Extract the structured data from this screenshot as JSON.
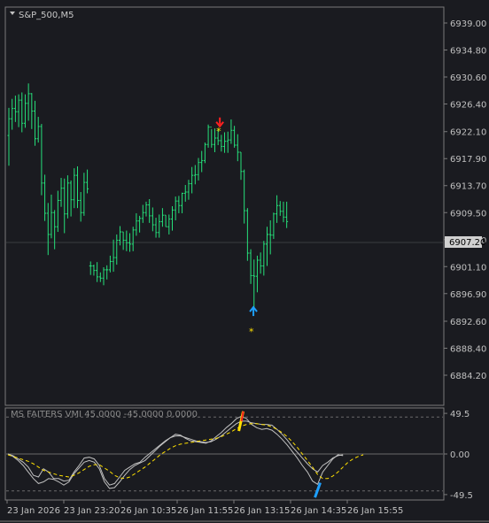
{
  "colors": {
    "background": "#1a1b20",
    "grid": "#3a3b40",
    "frame": "#7a7a7a",
    "bar": "#26e07a",
    "price_marker_bg": "#d0d0d0",
    "sell_arrow": "#ff2020",
    "buy_arrow": "#1ea0ff",
    "star": "#ffe000",
    "osc_main": "#c0c0c0",
    "osc_signal": "#ffe000"
  },
  "main": {
    "title": "S&P_500,M5",
    "current_price_label": "6907.20"
  },
  "sub": {
    "title": "MS FAITERS VMI 45.0000 -45.0000 0.0000"
  },
  "chart_data": [
    {
      "type": "ohlc",
      "title": "S&P_500,M5",
      "ylim": [
        6884.4,
        6939.0
      ],
      "y_ticks": [
        "6939.00",
        "6934.80",
        "6930.60",
        "6926.40",
        "6922.10",
        "6917.90",
        "6913.70",
        "6909.50",
        "6905.30",
        "6901.10",
        "6896.90",
        "6892.60",
        "6888.40",
        "6884.20"
      ],
      "x_ticks": [
        "23 Jan 2026",
        "23 Jan 23:20",
        "26 Jan 10:35",
        "26 Jan 11:55",
        "26 Jan 13:15",
        "26 Jan 14:35",
        "26 Jan 15:55"
      ],
      "current_price": 6907.2,
      "bars": [
        [
          6921.5,
          6925.8,
          6916.8,
          6924.1
        ],
        [
          6924.1,
          6927.2,
          6922.4,
          6925.7
        ],
        [
          6925.7,
          6927.7,
          6923.6,
          6925.2
        ],
        [
          6925.2,
          6927.9,
          6922.8,
          6927.0
        ],
        [
          6927.0,
          6928.2,
          6922.0,
          6923.4
        ],
        [
          6923.4,
          6927.9,
          6922.7,
          6926.5
        ],
        [
          6926.5,
          6929.6,
          6923.8,
          6928.0
        ],
        [
          6928.0,
          6928.1,
          6922.5,
          6925.3
        ],
        [
          6925.3,
          6926.9,
          6919.9,
          6921.0
        ],
        [
          6921.0,
          6924.4,
          6920.4,
          6922.9
        ],
        [
          6922.9,
          6923.3,
          6912.2,
          6914.1
        ],
        [
          6914.1,
          6915.4,
          6908.2,
          6909.4
        ],
        [
          6909.4,
          6911.0,
          6902.9,
          6906.1
        ],
        [
          6906.1,
          6912.3,
          6905.5,
          6909.5
        ],
        [
          6909.5,
          6909.9,
          6903.8,
          6907.3
        ],
        [
          6907.3,
          6912.9,
          6906.5,
          6911.4
        ],
        [
          6911.4,
          6914.9,
          6910.4,
          6913.3
        ],
        [
          6913.3,
          6914.8,
          6906.3,
          6909.3
        ],
        [
          6909.3,
          6915.3,
          6908.6,
          6914.1
        ],
        [
          6914.1,
          6914.5,
          6908.9,
          6911.5
        ],
        [
          6911.5,
          6916.4,
          6910.2,
          6915.3
        ],
        [
          6915.3,
          6916.7,
          6910.2,
          6911.4
        ],
        [
          6911.4,
          6912.7,
          6908.1,
          6909.5
        ],
        [
          6909.5,
          6915.7,
          6909.0,
          6914.2
        ],
        [
          6914.2,
          6916.2,
          6912.5,
          6913.2
        ],
        [
          6901.2,
          6901.9,
          6899.8,
          6901.2
        ],
        [
          6901.2,
          6901.4,
          6899.7,
          6900.5
        ],
        [
          6900.5,
          6901.8,
          6898.7,
          6899.5
        ],
        [
          6899.5,
          6900.2,
          6898.7,
          6899.3
        ],
        [
          6899.3,
          6901.0,
          6898.2,
          6900.6
        ],
        [
          6900.6,
          6901.3,
          6899.1,
          6900.6
        ],
        [
          6900.6,
          6902.8,
          6900.2,
          6901.9
        ],
        [
          6901.9,
          6905.3,
          6900.3,
          6902.5
        ],
        [
          6902.5,
          6906.1,
          6901.4,
          6905.2
        ],
        [
          6905.2,
          6907.4,
          6904.4,
          6906.5
        ],
        [
          6906.5,
          6906.5,
          6903.7,
          6905.2
        ],
        [
          6905.2,
          6906.7,
          6903.5,
          6904.8
        ],
        [
          6904.8,
          6906.3,
          6903.4,
          6904.6
        ],
        [
          6904.6,
          6907.3,
          6903.5,
          6906.8
        ],
        [
          6906.8,
          6909.4,
          6905.9,
          6908.2
        ],
        [
          6908.2,
          6909.0,
          6906.4,
          6908.6
        ],
        [
          6908.6,
          6910.7,
          6907.9,
          6909.5
        ],
        [
          6909.5,
          6911.2,
          6908.9,
          6910.7
        ],
        [
          6910.7,
          6911.6,
          6907.9,
          6909.0
        ],
        [
          6909.0,
          6910.3,
          6906.6,
          6907.6
        ],
        [
          6907.6,
          6908.7,
          6905.6,
          6906.4
        ],
        [
          6906.4,
          6909.2,
          6905.6,
          6908.1
        ],
        [
          6908.1,
          6910.2,
          6907.3,
          6909.1
        ],
        [
          6909.1,
          6909.1,
          6907.3,
          6907.3
        ],
        [
          6907.3,
          6909.2,
          6906.1,
          6908.5
        ],
        [
          6908.5,
          6910.5,
          6906.7,
          6909.9
        ],
        [
          6909.9,
          6912.0,
          6908.3,
          6911.3
        ],
        [
          6911.3,
          6912.1,
          6909.4,
          6910.6
        ],
        [
          6910.6,
          6912.6,
          6909.4,
          6912.5
        ],
        [
          6912.5,
          6913.8,
          6911.2,
          6912.7
        ],
        [
          6912.7,
          6914.6,
          6911.5,
          6914.0
        ],
        [
          6914.0,
          6916.6,
          6912.5,
          6915.3
        ],
        [
          6915.3,
          6916.9,
          6913.9,
          6915.4
        ],
        [
          6915.4,
          6918.0,
          6914.5,
          6917.3
        ],
        [
          6917.3,
          6919.1,
          6915.8,
          6917.6
        ],
        [
          6917.6,
          6920.4,
          6917.2,
          6920.1
        ],
        [
          6920.1,
          6923.2,
          6919.6,
          6922.8
        ],
        [
          6922.8,
          6922.5,
          6919.6,
          6920.1
        ],
        [
          6920.1,
          6922.6,
          6918.9,
          6921.1
        ],
        [
          6921.1,
          6922.5,
          6920.0,
          6920.7
        ],
        [
          6920.7,
          6921.6,
          6919.0,
          6919.8
        ],
        [
          6919.8,
          6922.0,
          6918.8,
          6920.6
        ],
        [
          6920.6,
          6922.1,
          6918.8,
          6920.8
        ],
        [
          6920.8,
          6924.0,
          6920.2,
          6922.3
        ],
        [
          6922.3,
          6923.0,
          6919.6,
          6920.0
        ],
        [
          6920.0,
          6921.7,
          6917.5,
          6918.9
        ],
        [
          6918.9,
          6918.9,
          6914.6,
          6915.9
        ],
        [
          6915.9,
          6916.2,
          6907.8,
          6909.8
        ],
        [
          6909.8,
          6910.2,
          6902.0,
          6903.2
        ],
        [
          6903.2,
          6903.8,
          6898.4,
          6899.7
        ],
        [
          6899.7,
          6902.2,
          6894.5,
          6899.6
        ],
        [
          6899.6,
          6902.8,
          6897.1,
          6902.1
        ],
        [
          6902.1,
          6903.3,
          6900.0,
          6901.2
        ],
        [
          6901.2,
          6905.1,
          6899.7,
          6904.6
        ],
        [
          6904.6,
          6907.3,
          6901.2,
          6906.1
        ],
        [
          6906.1,
          6908.3,
          6903.0,
          6906.0
        ],
        [
          6906.0,
          6909.5,
          6905.4,
          6909.3
        ],
        [
          6909.3,
          6912.2,
          6907.9,
          6910.6
        ],
        [
          6910.6,
          6911.3,
          6909.0,
          6909.7
        ],
        [
          6909.7,
          6911.2,
          6908.0,
          6908.8
        ],
        [
          6908.8,
          6911.2,
          6907.1,
          6908.1
        ]
      ],
      "gap_after_bar": 25,
      "signals": [
        {
          "kind": "sell_arrow",
          "bar": 64,
          "price": 6923.2
        },
        {
          "kind": "star",
          "bar": 64,
          "price": 6922.2
        },
        {
          "kind": "buy_arrow",
          "bar": 74,
          "price": 6894.1
        },
        {
          "kind": "star",
          "bar": 74,
          "price": 6891.0
        }
      ]
    },
    {
      "type": "line",
      "title": "MS FAITERS VMI 45.0000 -45.0000 0.0000",
      "ylim": [
        -55,
        55
      ],
      "y_ticks": [
        "49.5",
        "0.00",
        "-49.5"
      ],
      "levels": [
        45,
        0,
        -45
      ],
      "series": [
        {
          "values": [
            0,
            -2,
            -6,
            -10,
            -16,
            -26,
            -28,
            -18,
            -22,
            -30,
            -30,
            -33,
            -32,
            -22,
            -14,
            -5,
            -4,
            -6,
            -14,
            -30,
            -38,
            -36,
            -28,
            -20,
            -16,
            -12,
            -10,
            -4,
            1,
            6,
            11,
            16,
            20,
            22,
            22,
            20,
            18,
            16,
            15,
            14,
            15,
            18,
            22,
            27,
            32,
            37,
            40,
            40,
            38,
            37,
            36,
            36,
            35,
            30,
            24,
            17,
            9,
            2,
            -5,
            -12,
            -18,
            -22,
            -14,
            -10,
            -5,
            -2,
            -1
          ]
        },
        {
          "values": [
            0,
            -3,
            -8,
            -14,
            -22,
            -30,
            -36,
            -34,
            -30,
            -31,
            -34,
            -38,
            -34,
            -24,
            -17,
            -10,
            -8,
            -10,
            -18,
            -34,
            -42,
            -41,
            -34,
            -26,
            -19,
            -14,
            -11,
            -8,
            -2,
            4,
            10,
            15,
            20,
            24,
            23,
            19,
            16,
            15,
            14,
            13,
            16,
            21,
            26,
            32,
            37,
            43,
            46,
            43,
            36,
            32,
            30,
            31,
            29,
            24,
            18,
            11,
            3,
            -5,
            -14,
            -22,
            -33,
            -37,
            -22,
            -14,
            -6,
            -1,
            -2
          ]
        },
        {
          "values": [
            -1,
            -3,
            -5,
            -7,
            -9,
            -12,
            -16,
            -20,
            -22,
            -24,
            -26,
            -27,
            -28,
            -26,
            -23,
            -19,
            -15,
            -13,
            -13,
            -17,
            -21,
            -26,
            -29,
            -30,
            -28,
            -24,
            -20,
            -16,
            -11,
            -6,
            -1,
            3,
            7,
            10,
            12,
            13,
            14,
            15,
            16,
            17,
            18,
            19,
            21,
            24,
            27,
            31,
            34,
            36,
            37,
            37,
            36,
            35,
            33,
            30,
            26,
            21,
            15,
            8,
            0,
            -8,
            -16,
            -25,
            -30,
            -30,
            -27,
            -22,
            -16,
            -10,
            -6,
            -3,
            -1
          ]
        }
      ],
      "signal_marks": [
        {
          "kind": "sell_mark",
          "index": 46
        },
        {
          "kind": "buy_mark",
          "index": 61
        }
      ]
    }
  ]
}
